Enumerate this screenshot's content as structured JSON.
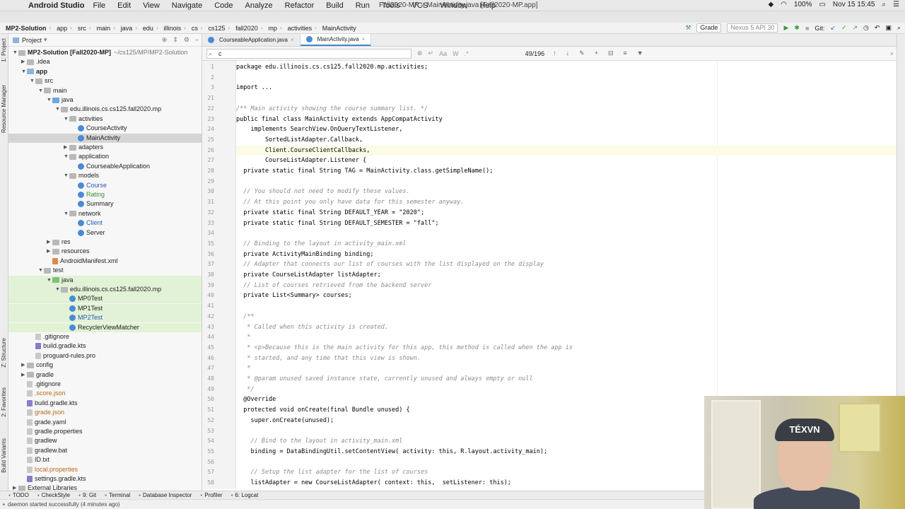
{
  "menubar": {
    "app_name": "Android Studio",
    "items": [
      "File",
      "Edit",
      "View",
      "Navigate",
      "Code",
      "Analyze",
      "Refactor",
      "Build",
      "Run",
      "Tools",
      "VCS",
      "Window",
      "Help"
    ],
    "window_title": "Fall2020-MP – MainActivity.java [Fall2020-MP.app]",
    "battery": "100%",
    "datetime": "Nov 15  15:45"
  },
  "navbar": {
    "crumbs": [
      "MP2-Solution",
      "app",
      "src",
      "main",
      "java",
      "edu",
      "illinois",
      "cs",
      "cs125",
      "fall2020",
      "mp",
      "activities",
      "MainActivity"
    ],
    "run_config": "Grade",
    "device": "Nexus 5 API 30",
    "git_label": "Git:"
  },
  "left_stripe": {
    "tabs": [
      "1: Project",
      "Resource Manager",
      "Z: Structure",
      "2: Favorites",
      "Build Variants"
    ]
  },
  "project": {
    "title": "Project",
    "rows": [
      {
        "label": "MP2-Solution [Fall2020-MP]",
        "extra": "~/cs125/MP/MP2-Solution",
        "indent": 0,
        "arrow": "▼",
        "icon": "folder-plain",
        "bold": true
      },
      {
        "label": ".idea",
        "indent": 1,
        "arrow": "▶",
        "icon": "folder-plain"
      },
      {
        "label": "app",
        "indent": 1,
        "arrow": "▼",
        "icon": "folder",
        "bold": true
      },
      {
        "label": "src",
        "indent": 2,
        "arrow": "▼",
        "icon": "folder-plain"
      },
      {
        "label": "main",
        "indent": 3,
        "arrow": "▼",
        "icon": "folder-plain"
      },
      {
        "label": "java",
        "indent": 4,
        "arrow": "▼",
        "icon": "folder-src"
      },
      {
        "label": "edu.illinois.cs.cs125.fall2020.mp",
        "indent": 5,
        "arrow": "▼",
        "icon": "folder-plain"
      },
      {
        "label": "activities",
        "indent": 6,
        "arrow": "▼",
        "icon": "folder-plain"
      },
      {
        "label": "CourseActivity",
        "indent": 7,
        "arrow": "",
        "icon": "cls"
      },
      {
        "label": "MainActivity",
        "indent": 7,
        "arrow": "",
        "icon": "cls",
        "selected": true
      },
      {
        "label": "adapters",
        "indent": 6,
        "arrow": "▶",
        "icon": "folder-plain"
      },
      {
        "label": "application",
        "indent": 6,
        "arrow": "▼",
        "icon": "folder-plain"
      },
      {
        "label": "CourseableApplication",
        "indent": 7,
        "arrow": "",
        "icon": "cls"
      },
      {
        "label": "models",
        "indent": 6,
        "arrow": "▼",
        "icon": "folder-plain"
      },
      {
        "label": "Course",
        "indent": 7,
        "arrow": "",
        "icon": "cls",
        "color": "blue"
      },
      {
        "label": "Rating",
        "indent": 7,
        "arrow": "",
        "icon": "cls",
        "color": "green"
      },
      {
        "label": "Summary",
        "indent": 7,
        "arrow": "",
        "icon": "cls"
      },
      {
        "label": "network",
        "indent": 6,
        "arrow": "▼",
        "icon": "folder-plain"
      },
      {
        "label": "Client",
        "indent": 7,
        "arrow": "",
        "icon": "cls",
        "color": "blue"
      },
      {
        "label": "Server",
        "indent": 7,
        "arrow": "",
        "icon": "cls"
      },
      {
        "label": "res",
        "indent": 4,
        "arrow": "▶",
        "icon": "folder-plain"
      },
      {
        "label": "resources",
        "indent": 4,
        "arrow": "▶",
        "icon": "folder-plain"
      },
      {
        "label": "AndroidManifest.xml",
        "indent": 4,
        "arrow": "",
        "icon": "file-x"
      },
      {
        "label": "test",
        "indent": 3,
        "arrow": "▼",
        "icon": "folder-plain"
      },
      {
        "label": "java",
        "indent": 4,
        "arrow": "▼",
        "icon": "folder-test",
        "green": true
      },
      {
        "label": "edu.illinois.cs.cs125.fall2020.mp",
        "indent": 5,
        "arrow": "▼",
        "icon": "folder-plain",
        "green": true
      },
      {
        "label": "MP0Test",
        "indent": 6,
        "arrow": "",
        "icon": "cls",
        "green": true
      },
      {
        "label": "MP1Test",
        "indent": 6,
        "arrow": "",
        "icon": "cls",
        "green": true
      },
      {
        "label": "MP2Test",
        "indent": 6,
        "arrow": "",
        "icon": "cls",
        "green": true,
        "color": "blue"
      },
      {
        "label": "RecyclerViewMatcher",
        "indent": 6,
        "arrow": "",
        "icon": "cls",
        "green": true
      },
      {
        "label": ".gitignore",
        "indent": 2,
        "arrow": "",
        "icon": "file"
      },
      {
        "label": "build.gradle.kts",
        "indent": 2,
        "arrow": "",
        "icon": "file-k"
      },
      {
        "label": "proguard-rules.pro",
        "indent": 2,
        "arrow": "",
        "icon": "file"
      },
      {
        "label": "config",
        "indent": 1,
        "arrow": "▶",
        "icon": "folder-plain"
      },
      {
        "label": "gradle",
        "indent": 1,
        "arrow": "▶",
        "icon": "folder-plain"
      },
      {
        "label": ".gitignore",
        "indent": 1,
        "arrow": "",
        "icon": "file"
      },
      {
        "label": ".score.json",
        "indent": 1,
        "arrow": "",
        "icon": "file",
        "color": "orange"
      },
      {
        "label": "build.gradle.kts",
        "indent": 1,
        "arrow": "",
        "icon": "file-k"
      },
      {
        "label": "grade.json",
        "indent": 1,
        "arrow": "",
        "icon": "file",
        "color": "orange"
      },
      {
        "label": "grade.yaml",
        "indent": 1,
        "arrow": "",
        "icon": "file"
      },
      {
        "label": "gradle.properties",
        "indent": 1,
        "arrow": "",
        "icon": "file"
      },
      {
        "label": "gradlew",
        "indent": 1,
        "arrow": "",
        "icon": "file"
      },
      {
        "label": "gradlew.bat",
        "indent": 1,
        "arrow": "",
        "icon": "file"
      },
      {
        "label": "ID.txt",
        "indent": 1,
        "arrow": "",
        "icon": "file"
      },
      {
        "label": "local.properties",
        "indent": 1,
        "arrow": "",
        "icon": "file",
        "color": "orange"
      },
      {
        "label": "settings.gradle.kts",
        "indent": 1,
        "arrow": "",
        "icon": "file-k"
      },
      {
        "label": "External Libraries",
        "indent": 0,
        "arrow": "▶",
        "icon": "folder-plain"
      }
    ]
  },
  "editor": {
    "tabs": [
      {
        "label": "CourseableApplication.java",
        "active": false
      },
      {
        "label": "MainActivity.java",
        "active": true
      }
    ],
    "find": {
      "query": "c",
      "match_count": "49/196"
    },
    "lines": [
      {
        "num": "1",
        "text": "package edu.illinois.cs.cs125.fall2020.mp.activities;"
      },
      {
        "num": "2",
        "text": ""
      },
      {
        "num": "3",
        "text": "import ..."
      },
      {
        "num": "21",
        "text": ""
      },
      {
        "num": "22",
        "text": "/** Main activity showing the course summary list. */",
        "comment": true
      },
      {
        "num": "23",
        "text": "public final class MainActivity extends AppCompatActivity"
      },
      {
        "num": "24",
        "text": "    implements SearchView.OnQueryTextListener,"
      },
      {
        "num": "25",
        "text": "        SortedListAdapter.Callback,"
      },
      {
        "num": "26",
        "text": "        Client.CourseClientCallbacks,",
        "current": true
      },
      {
        "num": "27",
        "text": "        CourseListAdapter.Listener {"
      },
      {
        "num": "28",
        "text": "  private static final String TAG = MainActivity.class.getSimpleName();"
      },
      {
        "num": "29",
        "text": ""
      },
      {
        "num": "30",
        "text": "  // You should not need to modify these values.",
        "comment": true
      },
      {
        "num": "31",
        "text": "  // At this point you only have data for this semester anyway.",
        "comment": true
      },
      {
        "num": "32",
        "text": "  private static final String DEFAULT_YEAR = \"2020\";"
      },
      {
        "num": "33",
        "text": "  private static final String DEFAULT_SEMESTER = \"fall\";"
      },
      {
        "num": "34",
        "text": ""
      },
      {
        "num": "35",
        "text": "  // Binding to the layout in activity_main.xml",
        "comment": true
      },
      {
        "num": "36",
        "text": "  private ActivityMainBinding binding;"
      },
      {
        "num": "37",
        "text": "  // Adapter that connects our list of courses with the list displayed on the display",
        "comment": true
      },
      {
        "num": "38",
        "text": "  private CourseListAdapter listAdapter;"
      },
      {
        "num": "39",
        "text": "  // List of courses retrieved from the backend server",
        "comment": true
      },
      {
        "num": "40",
        "text": "  private List<Summary> courses;"
      },
      {
        "num": "41",
        "text": ""
      },
      {
        "num": "42",
        "text": "  /**",
        "comment": true
      },
      {
        "num": "43",
        "text": "   * Called when this activity is created.",
        "comment": true
      },
      {
        "num": "44",
        "text": "   *",
        "comment": true
      },
      {
        "num": "45",
        "text": "   * <p>Because this is the main activity for this app, this method is called when the app is",
        "comment": true
      },
      {
        "num": "46",
        "text": "   * started, and any time that this view is shown.",
        "comment": true
      },
      {
        "num": "47",
        "text": "   *",
        "comment": true
      },
      {
        "num": "48",
        "text": "   * @param unused saved instance state, currently unused and always empty or null",
        "comment": true
      },
      {
        "num": "49",
        "text": "   */",
        "comment": true
      },
      {
        "num": "50",
        "text": "  @Override"
      },
      {
        "num": "51",
        "text": "  protected void onCreate(final Bundle unused) {"
      },
      {
        "num": "52",
        "text": "    super.onCreate(unused);"
      },
      {
        "num": "53",
        "text": ""
      },
      {
        "num": "54",
        "text": "    // Bind to the layout in activity_main.xml",
        "comment": true
      },
      {
        "num": "55",
        "text": "    binding = DataBindingUtil.setContentView( activity: this, R.layout.activity_main);"
      },
      {
        "num": "56",
        "text": ""
      },
      {
        "num": "57",
        "text": "    // Setup the list adapter for the list of courses",
        "comment": true
      },
      {
        "num": "58",
        "text": "    listAdapter = new CourseListAdapter( context: this,  setListener: this);"
      }
    ]
  },
  "webcam": {
    "cap_text": "TÉXVN"
  },
  "bottom_tools": [
    {
      "label": "TODO"
    },
    {
      "label": "CheckStyle"
    },
    {
      "label": "9: Git"
    },
    {
      "label": "Terminal"
    },
    {
      "label": "Database Inspector"
    },
    {
      "label": "Profiler"
    },
    {
      "label": "6: Logcat"
    }
  ],
  "status": {
    "message": "daemon started successfully (4 minutes ago)"
  }
}
